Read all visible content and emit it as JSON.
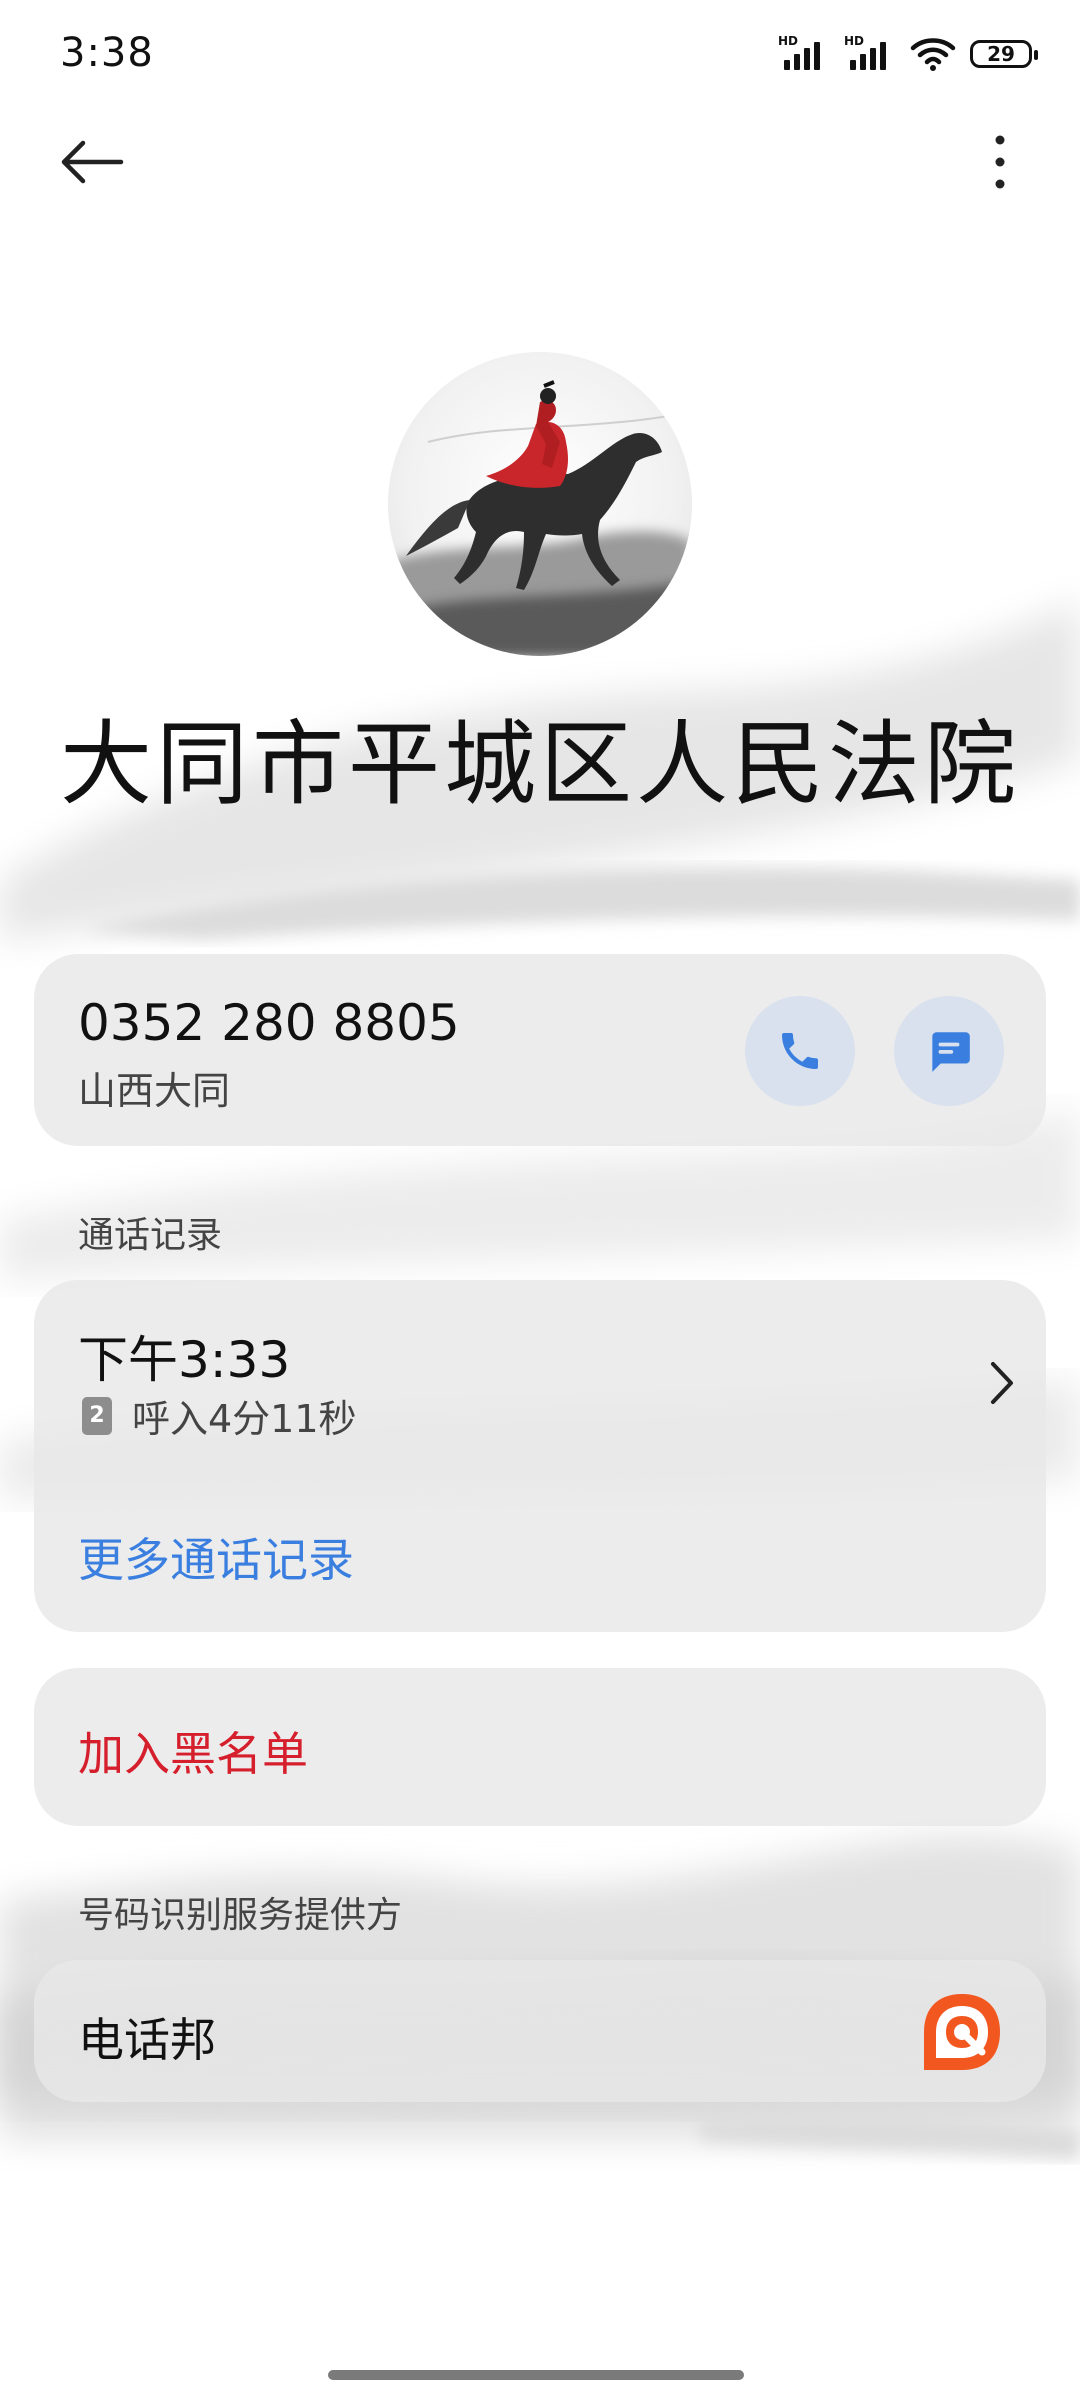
{
  "status_bar": {
    "time": "3:38",
    "sim1_tag": "HD",
    "sim2_tag": "HD",
    "battery": "29"
  },
  "top_bar": {
    "back_icon": "arrow-left-icon",
    "more_icon": "more-vertical-icon"
  },
  "contact": {
    "name": "大同市平城区人民法院",
    "phone_number": "0352 280 8805",
    "location": "山西大同",
    "call_icon": "phone-icon",
    "message_icon": "message-icon"
  },
  "call_log": {
    "section_label": "通话记录",
    "time": "下午3:33",
    "sim_slot": "2",
    "detail": "呼入4分11秒",
    "more_link": "更多通话记录"
  },
  "block": {
    "label": "加入黑名单"
  },
  "provider": {
    "section_label": "号码识别服务提供方",
    "name": "电话邦",
    "logo_icon": "dianhuabang-logo-icon"
  },
  "colors": {
    "accent_blue": "#3a7fe0",
    "danger_red": "#d61f2c",
    "provider_orange": "#f2571f",
    "card_bg": "#e8e8e8",
    "round_button_bg": "#d9e1ee"
  }
}
